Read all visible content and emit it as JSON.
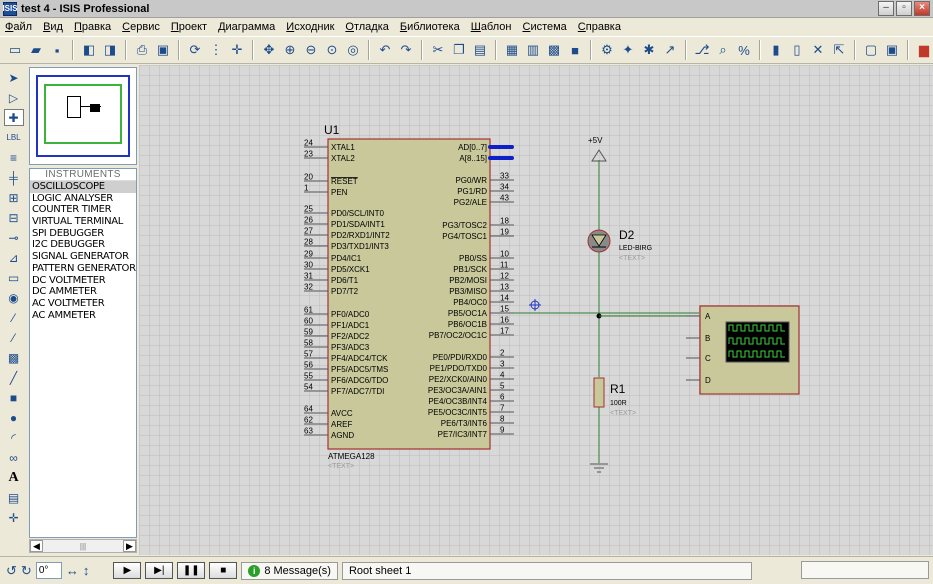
{
  "window": {
    "title": "test 4 - ISIS Professional",
    "app_icon": "ISIS"
  },
  "menu": [
    "Файл",
    "Вид",
    "Правка",
    "Сервис",
    "Проект",
    "Диаграмма",
    "Исходник",
    "Отладка",
    "Библиотека",
    "Шаблон",
    "Система",
    "Справка"
  ],
  "colors": {
    "grid_bg": "#d8d8d8",
    "grid_line": "#b8b8b8",
    "grid_major": "#a9a9a9",
    "component_fill": "#c8c89b",
    "component_stroke": "#a53131",
    "wire": "#2e7d32",
    "bus": "#1020c8"
  },
  "instruments": {
    "header": "INSTRUMENTS",
    "items": [
      "OSCILLOSCOPE",
      "LOGIC ANALYSER",
      "COUNTER TIMER",
      "VIRTUAL TERMINAL",
      "SPI DEBUGGER",
      "I2C DEBUGGER",
      "SIGNAL GENERATOR",
      "PATTERN GENERATOR",
      "DC VOLTMETER",
      "DC AMMETER",
      "AC VOLTMETER",
      "AC AMMETER"
    ],
    "selected": "OSCILLOSCOPE"
  },
  "schematic": {
    "u1": {
      "ref": "U1",
      "part": "ATMEGA128",
      "text": "<TEXT>",
      "left_pins": [
        {
          "num": "24",
          "name": "XTAL1"
        },
        {
          "num": "23",
          "name": "XTAL2"
        },
        {
          "num": "20",
          "name": "RESET"
        },
        {
          "num": "1",
          "name": "PEN"
        },
        {
          "num": "25",
          "name": "PD0/SCL/INT0"
        },
        {
          "num": "26",
          "name": "PD1/SDA/INT1"
        },
        {
          "num": "27",
          "name": "PD2/RXD1/INT2"
        },
        {
          "num": "28",
          "name": "PD3/TXD1/INT3"
        },
        {
          "num": "29",
          "name": "PD4/IC1"
        },
        {
          "num": "30",
          "name": "PD5/XCK1"
        },
        {
          "num": "31",
          "name": "PD6/T1"
        },
        {
          "num": "32",
          "name": "PD7/T2"
        },
        {
          "num": "61",
          "name": "PF0/ADC0"
        },
        {
          "num": "60",
          "name": "PF1/ADC1"
        },
        {
          "num": "59",
          "name": "PF2/ADC2"
        },
        {
          "num": "58",
          "name": "PF3/ADC3"
        },
        {
          "num": "57",
          "name": "PF4/ADC4/TCK"
        },
        {
          "num": "56",
          "name": "PF5/ADC5/TMS"
        },
        {
          "num": "55",
          "name": "PF6/ADC6/TDO"
        },
        {
          "num": "54",
          "name": "PF7/ADC7/TDI"
        },
        {
          "num": "64",
          "name": "AVCC"
        },
        {
          "num": "62",
          "name": "AREF"
        },
        {
          "num": "63",
          "name": "AGND"
        }
      ],
      "right_pins": [
        {
          "num": "",
          "name": "AD[0..7]"
        },
        {
          "num": "",
          "name": "A[8..15]"
        },
        {
          "num": "33",
          "name": "PG0/WR"
        },
        {
          "num": "34",
          "name": "PG1/RD"
        },
        {
          "num": "43",
          "name": "PG2/ALE"
        },
        {
          "num": "18",
          "name": "PG3/TOSC2"
        },
        {
          "num": "19",
          "name": "PG4/TOSC1"
        },
        {
          "num": "10",
          "name": "PB0/SS"
        },
        {
          "num": "11",
          "name": "PB1/SCK"
        },
        {
          "num": "12",
          "name": "PB2/MOSI"
        },
        {
          "num": "13",
          "name": "PB3/MISO"
        },
        {
          "num": "14",
          "name": "PB4/OC0"
        },
        {
          "num": "15",
          "name": "PB5/OC1A"
        },
        {
          "num": "16",
          "name": "PB6/OC1B"
        },
        {
          "num": "17",
          "name": "PB7/OC2/OC1C"
        },
        {
          "num": "2",
          "name": "PE0/PDI/RXD0"
        },
        {
          "num": "3",
          "name": "PE1/PDO/TXD0"
        },
        {
          "num": "4",
          "name": "PE2/XCK0/AIN0"
        },
        {
          "num": "5",
          "name": "PE3/OC3A/AIN1"
        },
        {
          "num": "6",
          "name": "PE4/OC3B/INT4"
        },
        {
          "num": "7",
          "name": "PE5/OC3C/INT5"
        },
        {
          "num": "8",
          "name": "PE6/T3/INT6"
        },
        {
          "num": "9",
          "name": "PE7/IC3/INT7"
        }
      ]
    },
    "d2": {
      "ref": "D2",
      "part": "LED-BIRG",
      "text": "<TEXT>"
    },
    "r1": {
      "ref": "R1",
      "value": "100R",
      "text": "<TEXT>"
    },
    "power": "+5V",
    "scope": {
      "channels": [
        "A",
        "B",
        "C",
        "D"
      ]
    }
  },
  "statusbar": {
    "rotation": "0°",
    "messages": "8 Message(s)",
    "sheet": "Root sheet 1"
  }
}
